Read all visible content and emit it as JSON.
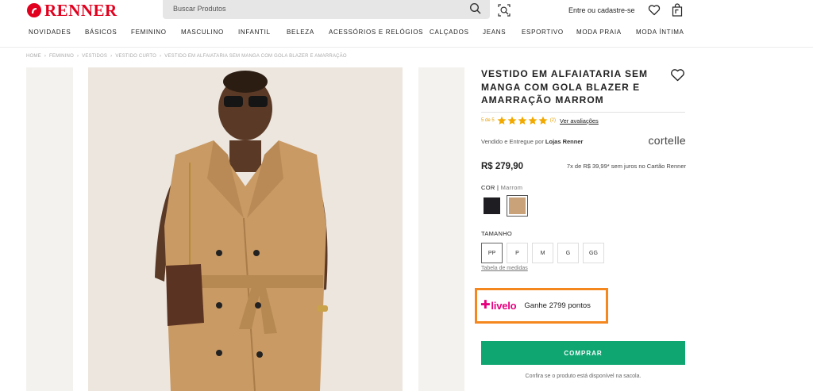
{
  "header": {
    "brand_name": "RENNER",
    "search": {
      "placeholder": "Buscar Produtos"
    },
    "login_label": "Entre ou cadastre-se",
    "nav": [
      "NOVIDADES",
      "BÁSICOS",
      "FEMININO",
      "MASCULINO",
      "INFANTIL",
      "BELEZA",
      "ACESSÓRIOS E RELÓGIOS",
      "CALÇADOS",
      "JEANS",
      "ESPORTIVO",
      "MODA PRAIA",
      "MODA ÍNTIMA"
    ],
    "icons": [
      "search-icon",
      "visual-search-icon",
      "heart-icon",
      "shopping-bag-icon"
    ]
  },
  "breadcrumb": [
    "HOME",
    "FEMININO",
    "VESTIDOS",
    "VESTIDO CURTO",
    "VESTIDO EM ALFAIATARIA SEM MANGA COM GOLA BLAZER E AMARRAÇÃO"
  ],
  "product": {
    "title": "VESTIDO EM ALFAIATARIA SEM MANGA COM GOLA BLAZER E AMARRAÇÃO MARROM",
    "rating": {
      "score_text": "5 de 5",
      "stars": 5,
      "count_text": "(2)",
      "reviews_link": "Ver avaliações"
    },
    "seller_prefix": "Vendido e Entregue por",
    "seller_name": "Lojas Renner",
    "brand": "cortelle",
    "price": "R$ 279,90",
    "installments": "7x de R$ 39,99* sem juros no Cartão Renner",
    "color": {
      "label": "COR",
      "selected": "Marrom",
      "swatches": [
        {
          "name": "Preto",
          "hex": "#1e1e22",
          "selected": false
        },
        {
          "name": "Marrom",
          "hex": "#c9a27a",
          "selected": true
        }
      ]
    },
    "size": {
      "label": "TAMANHO",
      "options": [
        "PP",
        "P",
        "M",
        "G",
        "GG"
      ],
      "selected": "PP",
      "table_link": "Tabela de medidas"
    },
    "livelo": {
      "brand": "livelo",
      "points_text": "Ganhe 2799 pontos",
      "accent": "#e6007e",
      "highlight": "#f5871f"
    },
    "buy_label": "COMPRAR",
    "buy_color": "#0fa672",
    "bag_note": "Confira se o produto está disponível na sacola."
  },
  "colors": {
    "brand_red": "#e1001e",
    "star": "#f2a900"
  }
}
